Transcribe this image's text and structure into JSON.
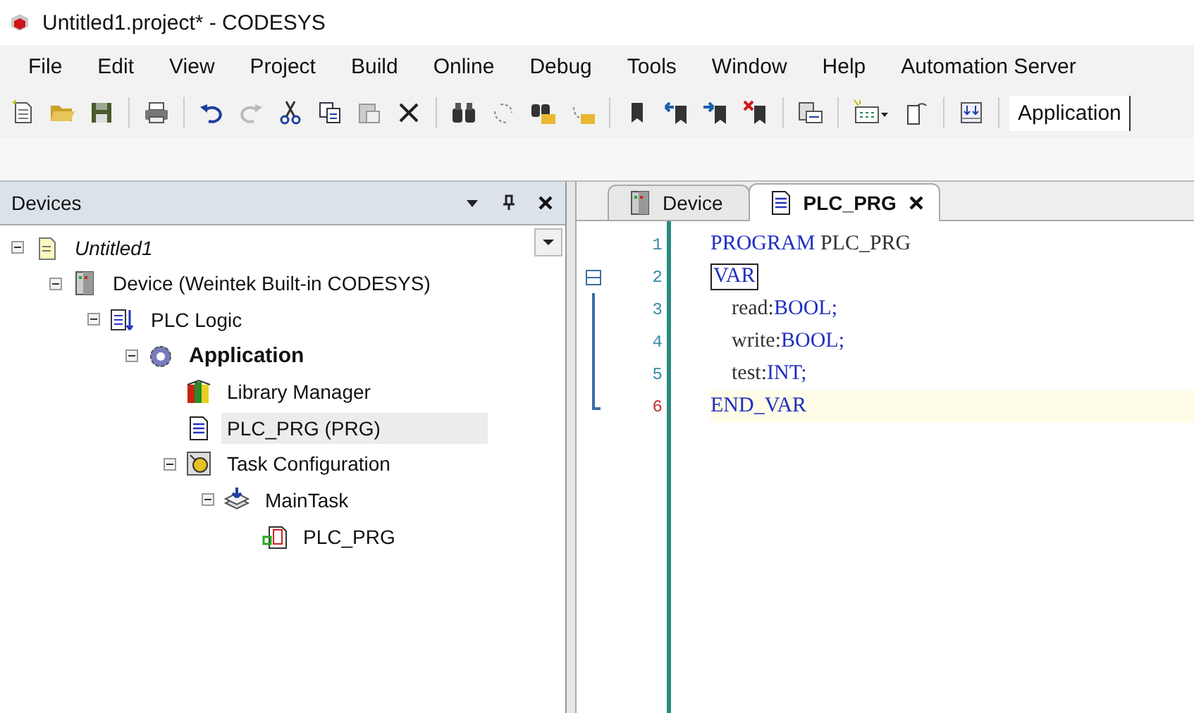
{
  "window": {
    "title": "Untitled1.project* - CODESYS"
  },
  "menu": [
    "File",
    "Edit",
    "View",
    "Project",
    "Build",
    "Online",
    "Debug",
    "Tools",
    "Window",
    "Help",
    "Automation Server"
  ],
  "toolbar": {
    "active_application": "Application"
  },
  "devices_pane": {
    "title": "Devices",
    "tree": [
      {
        "label": "Untitled1",
        "kind": "project",
        "italic": true,
        "bold": false,
        "expanded": true,
        "selected": false,
        "children": [
          {
            "label": "Device (Weintek Built-in CODESYS)",
            "kind": "device",
            "italic": false,
            "bold": false,
            "expanded": true,
            "selected": false,
            "children": [
              {
                "label": "PLC Logic",
                "kind": "logic",
                "italic": false,
                "bold": false,
                "expanded": true,
                "selected": false,
                "children": [
                  {
                    "label": "Application",
                    "kind": "application",
                    "italic": false,
                    "bold": true,
                    "expanded": true,
                    "selected": false,
                    "children": [
                      {
                        "label": "Library Manager",
                        "kind": "library",
                        "italic": false,
                        "bold": false,
                        "selected": false
                      },
                      {
                        "label": "PLC_PRG (PRG)",
                        "kind": "pou",
                        "italic": false,
                        "bold": false,
                        "selected": true
                      },
                      {
                        "label": "Task Configuration",
                        "kind": "taskconfig",
                        "italic": false,
                        "bold": false,
                        "expanded": true,
                        "selected": false,
                        "children": [
                          {
                            "label": "MainTask",
                            "kind": "task",
                            "italic": false,
                            "bold": false,
                            "expanded": true,
                            "selected": false,
                            "children": [
                              {
                                "label": "PLC_PRG",
                                "kind": "call",
                                "italic": false,
                                "bold": false,
                                "selected": false
                              }
                            ]
                          }
                        ]
                      }
                    ]
                  }
                ]
              }
            ]
          }
        ]
      }
    ]
  },
  "editor": {
    "tabs": [
      {
        "label": "Device",
        "kind": "device",
        "selected": false,
        "closable": false
      },
      {
        "label": "PLC_PRG",
        "kind": "pou",
        "selected": true,
        "closable": true
      }
    ],
    "lines": [
      {
        "number": "1",
        "current": false,
        "kind": "plain",
        "segments": [
          {
            "text": "PROGRAM",
            "kind": "keyword"
          },
          {
            "text": " PLC_PRG",
            "kind": "plain"
          }
        ]
      },
      {
        "number": "2",
        "current": false,
        "kind": "fold_start",
        "segments": [
          {
            "text": "VAR",
            "kind": "boxed"
          }
        ]
      },
      {
        "number": "3",
        "current": false,
        "kind": "fold_body",
        "segments": [
          {
            "text": "    read:",
            "kind": "plain"
          },
          {
            "text": "BOOL;",
            "kind": "keyword"
          }
        ]
      },
      {
        "number": "4",
        "current": false,
        "kind": "fold_body",
        "segments": [
          {
            "text": "    write:",
            "kind": "plain"
          },
          {
            "text": "BOOL;",
            "kind": "keyword"
          }
        ]
      },
      {
        "number": "5",
        "current": false,
        "kind": "fold_body",
        "segments": [
          {
            "text": "    test:",
            "kind": "plain"
          },
          {
            "text": "INT;",
            "kind": "keyword"
          }
        ]
      },
      {
        "number": "6",
        "current": true,
        "kind": "fold_end",
        "segments": [
          {
            "text": "END_VAR",
            "kind": "keyword"
          }
        ]
      }
    ]
  }
}
